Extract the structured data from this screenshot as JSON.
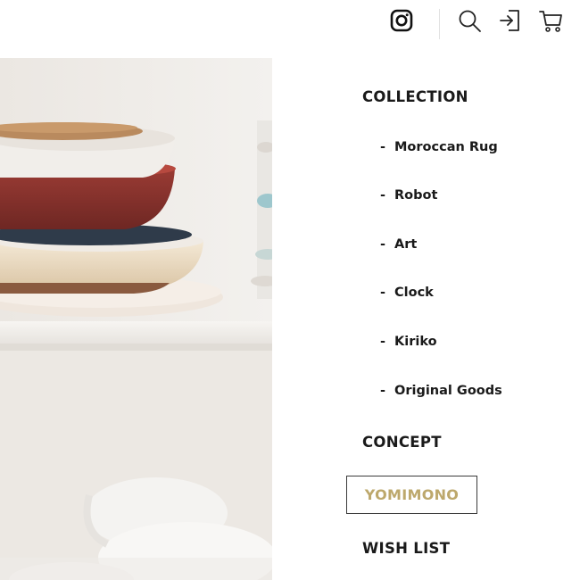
{
  "header": {
    "icons": [
      "instagram-icon",
      "search-icon",
      "login-icon",
      "cart-icon"
    ]
  },
  "menu": {
    "collection_label": "COLLECTION",
    "collection_items": [
      {
        "dash": "-",
        "label": "Moroccan Rug"
      },
      {
        "dash": "-",
        "label": "Robot"
      },
      {
        "dash": "-",
        "label": "Art"
      },
      {
        "dash": "-",
        "label": "Clock"
      },
      {
        "dash": "-",
        "label": "Kiriko"
      },
      {
        "dash": "-",
        "label": "Original Goods"
      }
    ],
    "concept_label": "CONCEPT",
    "yomimono_label": "YOMIMONO",
    "wishlist_label": "WISH LIST"
  },
  "colors": {
    "text": "#1a1a1a",
    "accent": "#bda86c",
    "background": "#ffffff"
  }
}
